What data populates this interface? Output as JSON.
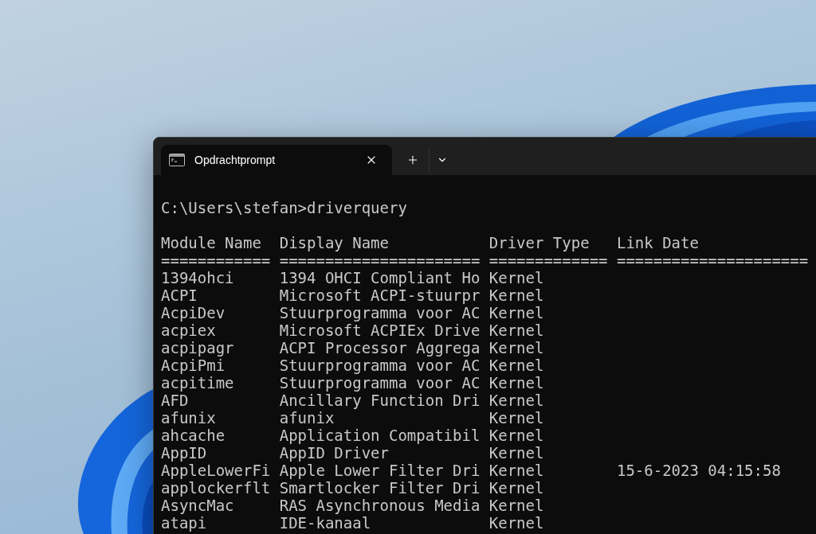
{
  "tabs": [
    {
      "title": "Opdrachtprompt",
      "selected": true
    }
  ],
  "terminal": {
    "command_line": "C:\\Users\\stefan>driverquery",
    "columns": [
      {
        "heading": "Module Name",
        "underline": "============"
      },
      {
        "heading": "Display Name",
        "underline": "======================"
      },
      {
        "heading": "Driver Type",
        "underline": "============="
      },
      {
        "heading": "Link Date",
        "underline": "====================="
      }
    ],
    "rows": [
      {
        "module_name": "1394ohci",
        "display_name": "1394 OHCI Compliant Ho",
        "driver_type": "Kernel"
      },
      {
        "module_name": "ACPI",
        "display_name": "Microsoft ACPI-stuurpr",
        "driver_type": "Kernel"
      },
      {
        "module_name": "AcpiDev",
        "display_name": "Stuurprogramma voor AC",
        "driver_type": "Kernel"
      },
      {
        "module_name": "acpiex",
        "display_name": "Microsoft ACPIEx Drive",
        "driver_type": "Kernel"
      },
      {
        "module_name": "acpipagr",
        "display_name": "ACPI Processor Aggrega",
        "driver_type": "Kernel"
      },
      {
        "module_name": "AcpiPmi",
        "display_name": "Stuurprogramma voor AC",
        "driver_type": "Kernel"
      },
      {
        "module_name": "acpitime",
        "display_name": "Stuurprogramma voor AC",
        "driver_type": "Kernel"
      },
      {
        "module_name": "AFD",
        "display_name": "Ancillary Function Dri",
        "driver_type": "Kernel"
      },
      {
        "module_name": "afunix",
        "display_name": "afunix",
        "driver_type": "Kernel"
      },
      {
        "module_name": "ahcache",
        "display_name": "Application Compatibil",
        "driver_type": "Kernel"
      },
      {
        "module_name": "AppID",
        "display_name": "AppID Driver",
        "driver_type": "Kernel"
      },
      {
        "module_name": "AppleLowerFi",
        "display_name": "Apple Lower Filter Dri",
        "driver_type": "Kernel",
        "link_date": "15-6-2023 04:15:58"
      },
      {
        "module_name": "applockerflt",
        "display_name": "Smartlocker Filter Dri",
        "driver_type": "Kernel"
      },
      {
        "module_name": "AsyncMac",
        "display_name": "RAS Asynchronous Media",
        "driver_type": "Kernel"
      },
      {
        "module_name": "atapi",
        "display_name": "IDE-kanaal",
        "driver_type": "Kernel"
      }
    ]
  }
}
